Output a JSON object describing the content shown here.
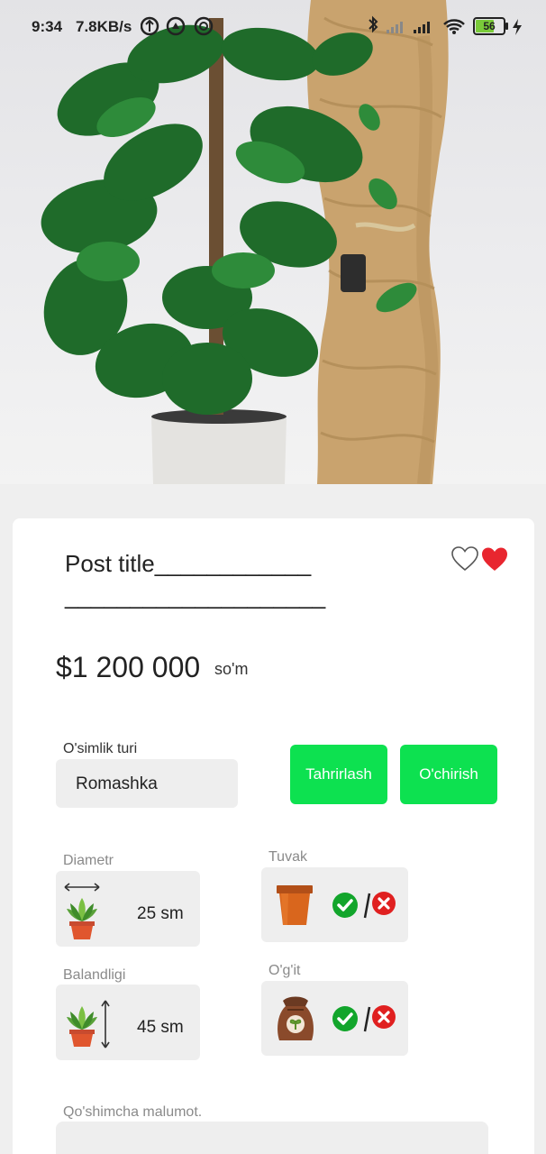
{
  "status_bar": {
    "time": "9:34",
    "speed": "7.8KB/s",
    "battery": "56"
  },
  "post": {
    "title": "Post title____________",
    "title_line2": "____________________",
    "price": "$1 200 000",
    "currency": "so'm"
  },
  "plant_type": {
    "label": "O'simlik turi",
    "value": "Romashka"
  },
  "actions": {
    "edit_label": "Tahrirlash",
    "delete_label": "O'chirish"
  },
  "diameter": {
    "label": "Diametr",
    "value": "25 sm"
  },
  "pot": {
    "label": "Tuvak"
  },
  "height": {
    "label": "Balandligi",
    "value": "45 sm"
  },
  "fertilizer": {
    "label": "O'g'it"
  },
  "extra": {
    "label": "Qo'shimcha malumot."
  },
  "icons": {
    "favorite_outline": "heart-outline-icon",
    "favorite_filled": "heart-filled-icon",
    "pot": "flower-pot-icon",
    "fertilizer": "fertilizer-bag-icon",
    "yes": "check-circle-icon",
    "no": "x-circle-icon"
  },
  "colors": {
    "accent_green": "#0de150",
    "heart_red": "#e8262f",
    "check_green": "#12a52b",
    "cross_red": "#e02020"
  }
}
